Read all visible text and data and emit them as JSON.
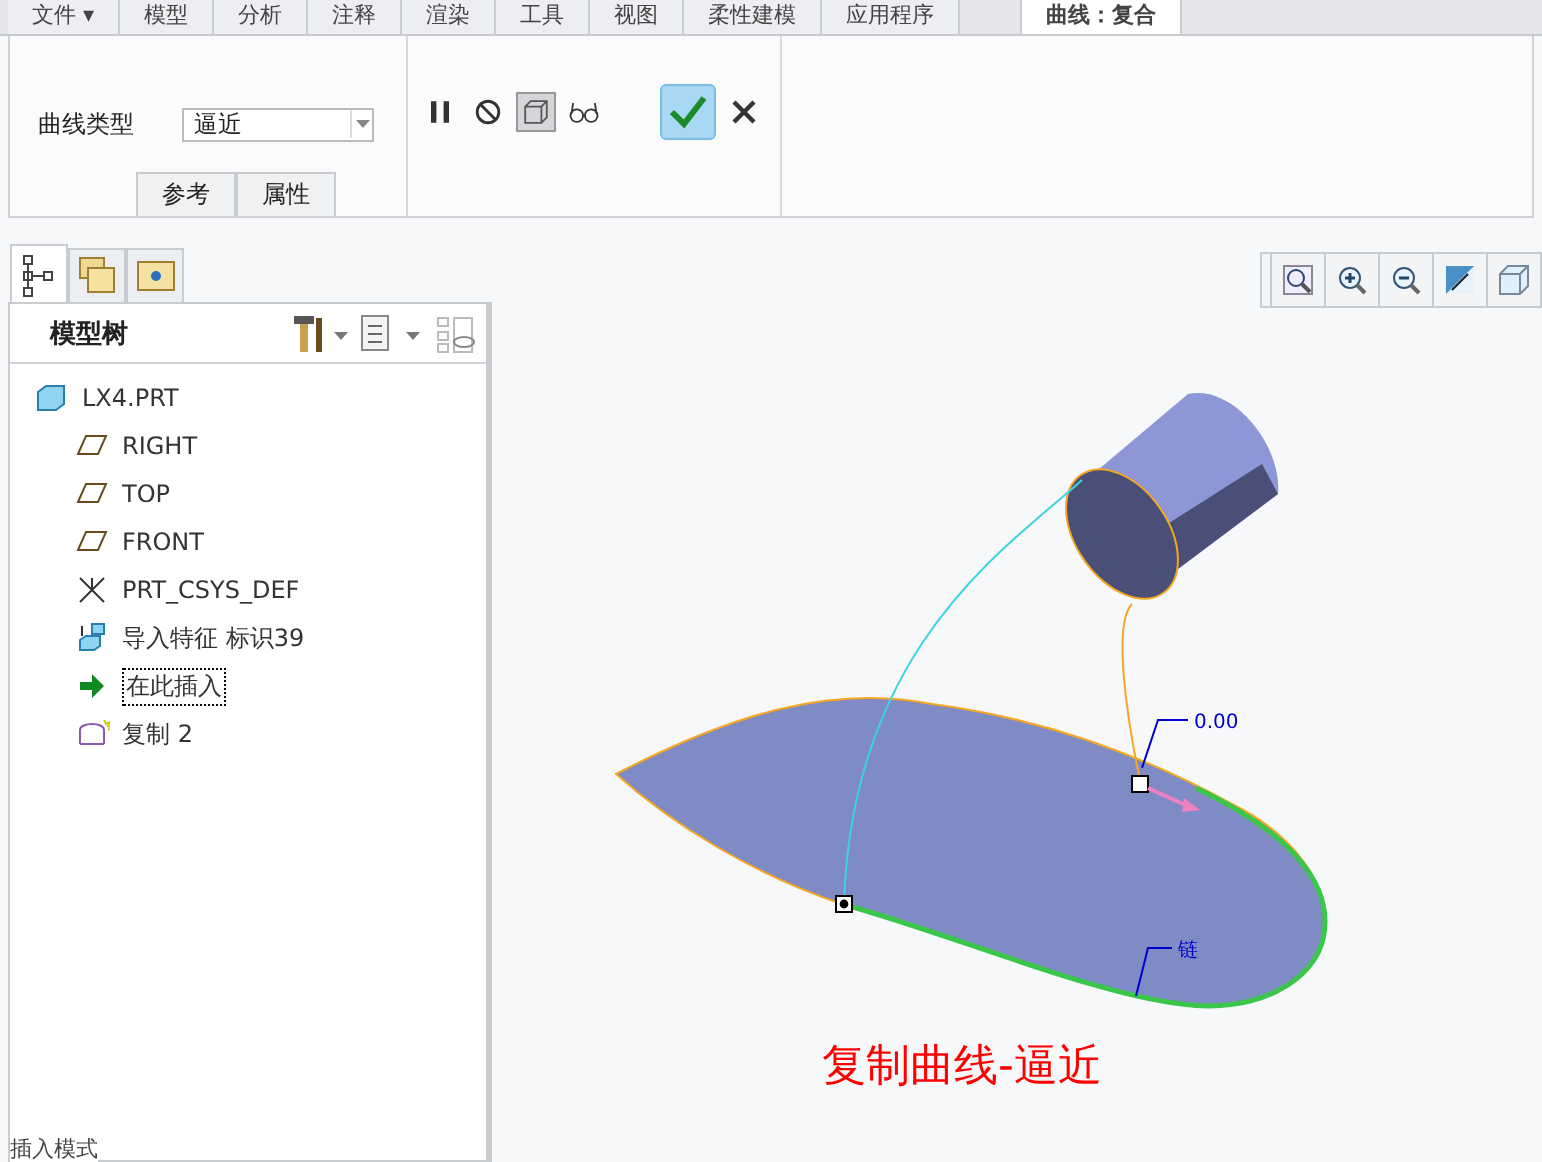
{
  "menu_tabs": [
    {
      "label": "文件 ▾",
      "selected": false
    },
    {
      "label": "模型",
      "selected": false
    },
    {
      "label": "分析",
      "selected": false
    },
    {
      "label": "注释",
      "selected": false
    },
    {
      "label": "渲染",
      "selected": false
    },
    {
      "label": "工具",
      "selected": false
    },
    {
      "label": "视图",
      "selected": false
    },
    {
      "label": "柔性建模",
      "selected": false
    },
    {
      "label": "应用程序",
      "selected": false
    },
    {
      "label": "曲线：复合",
      "selected": true
    }
  ],
  "ribbon": {
    "curve_type_label": "曲线类型",
    "curve_type_value": "逼近",
    "panel_tabs": [
      {
        "label": "参考"
      },
      {
        "label": "属性"
      }
    ],
    "tools": [
      {
        "kind": "pause",
        "on": false
      },
      {
        "kind": "no",
        "on": false
      },
      {
        "kind": "preview",
        "on": true
      },
      {
        "kind": "glasses",
        "on": false
      }
    ]
  },
  "model_tree": {
    "tabs": [
      {
        "kind": "tree",
        "selected": true
      },
      {
        "kind": "folders",
        "selected": false
      },
      {
        "kind": "favorites",
        "selected": false
      }
    ],
    "title": "模型树",
    "items": [
      {
        "kind": "part",
        "label": "LX4.PRT",
        "children": [
          {
            "kind": "plane",
            "label": "RIGHT"
          },
          {
            "kind": "plane",
            "label": "TOP"
          },
          {
            "kind": "plane",
            "label": "FRONT"
          },
          {
            "kind": "csys",
            "label": "PRT_CSYS_DEF"
          },
          {
            "kind": "import",
            "label": "导入特征 标识39"
          },
          {
            "kind": "insert",
            "label": "在此插入"
          },
          {
            "kind": "copy",
            "label": "复制 2"
          }
        ]
      }
    ]
  },
  "graphics": {
    "dimension_label": "0.00",
    "chain_label": "链",
    "caption": "复制曲线-逼近"
  },
  "status_bar": {
    "text": "插入模式"
  }
}
